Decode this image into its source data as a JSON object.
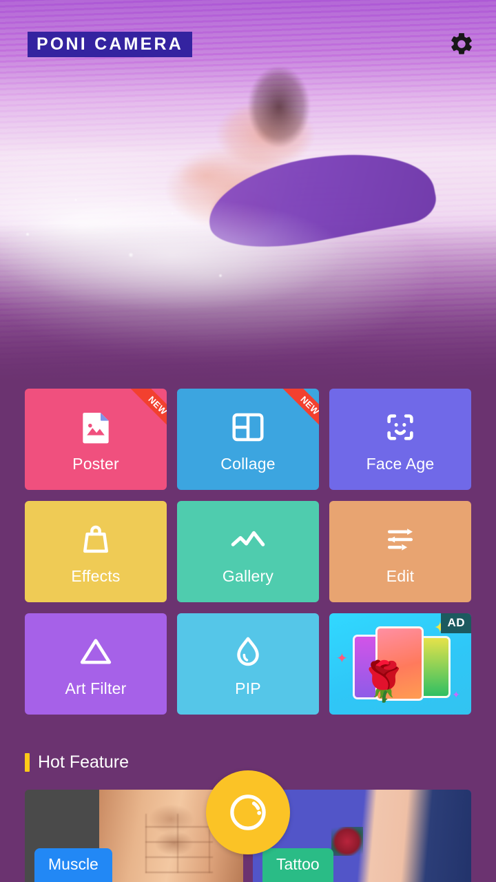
{
  "app": {
    "logo_text": "PONI CAMERA",
    "background_color": "#6B3370"
  },
  "header": {
    "settings_icon": "gear-icon"
  },
  "hero": {
    "description": "underwater surfer photo with purple tint"
  },
  "grid": {
    "tiles": [
      {
        "label": "Poster",
        "icon": "image-file-icon",
        "color": "#F0507E",
        "badge": "NEW"
      },
      {
        "label": "Collage",
        "icon": "grid-layout-icon",
        "color": "#3CA5E0",
        "badge": "NEW"
      },
      {
        "label": "Face Age",
        "icon": "face-scan-icon",
        "color": "#7069E8",
        "badge": ""
      },
      {
        "label": "Effects",
        "icon": "handbag-icon",
        "color": "#EFCB55",
        "badge": ""
      },
      {
        "label": "Gallery",
        "icon": "mountains-icon",
        "color": "#4FCCAE",
        "badge": ""
      },
      {
        "label": "Edit",
        "icon": "sliders-icon",
        "color": "#E8A471",
        "badge": ""
      }
    ],
    "tiles_row3": [
      {
        "label": "Art Filter",
        "icon": "triangle-icon",
        "color": "#A濾"
      }
    ],
    "art_filter": {
      "label": "Art Filter",
      "icon": "triangle-icon",
      "color": "#A661E8"
    },
    "pip": {
      "label": "PIP",
      "icon": "droplet-icon",
      "color": "#55C6E8"
    },
    "ad": {
      "badge": "AD",
      "icon": "rose-cards-ad-icon",
      "color": "#31D8FF"
    }
  },
  "hot_feature": {
    "title": "Hot Feature",
    "accent_color": "#FFC918",
    "cards": [
      {
        "label": "Muscle",
        "chip_color": "#2288F5"
      },
      {
        "label": "Tattoo",
        "chip_color": "#2ABC86"
      }
    ]
  },
  "fab": {
    "icon": "camera-lens-icon",
    "color": "#FBC326"
  }
}
